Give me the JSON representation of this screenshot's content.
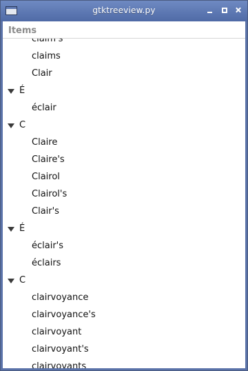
{
  "window": {
    "title": "gtktreeview.py"
  },
  "column_header": "Items",
  "rows": [
    {
      "label": "claim's",
      "kind": "child"
    },
    {
      "label": "claims",
      "kind": "child"
    },
    {
      "label": "Clair",
      "kind": "child"
    },
    {
      "label": "É",
      "kind": "parent",
      "expanded": true
    },
    {
      "label": "éclair",
      "kind": "child"
    },
    {
      "label": "C",
      "kind": "parent",
      "expanded": true
    },
    {
      "label": "Claire",
      "kind": "child"
    },
    {
      "label": "Claire's",
      "kind": "child"
    },
    {
      "label": "Clairol",
      "kind": "child"
    },
    {
      "label": "Clairol's",
      "kind": "child"
    },
    {
      "label": "Clair's",
      "kind": "child"
    },
    {
      "label": "É",
      "kind": "parent",
      "expanded": true
    },
    {
      "label": "éclair's",
      "kind": "child"
    },
    {
      "label": "éclairs",
      "kind": "child"
    },
    {
      "label": "C",
      "kind": "parent",
      "expanded": true
    },
    {
      "label": "clairvoyance",
      "kind": "child"
    },
    {
      "label": "clairvoyance's",
      "kind": "child"
    },
    {
      "label": "clairvoyant",
      "kind": "child"
    },
    {
      "label": "clairvoyant's",
      "kind": "child"
    },
    {
      "label": "clairvoyants",
      "kind": "child"
    }
  ]
}
